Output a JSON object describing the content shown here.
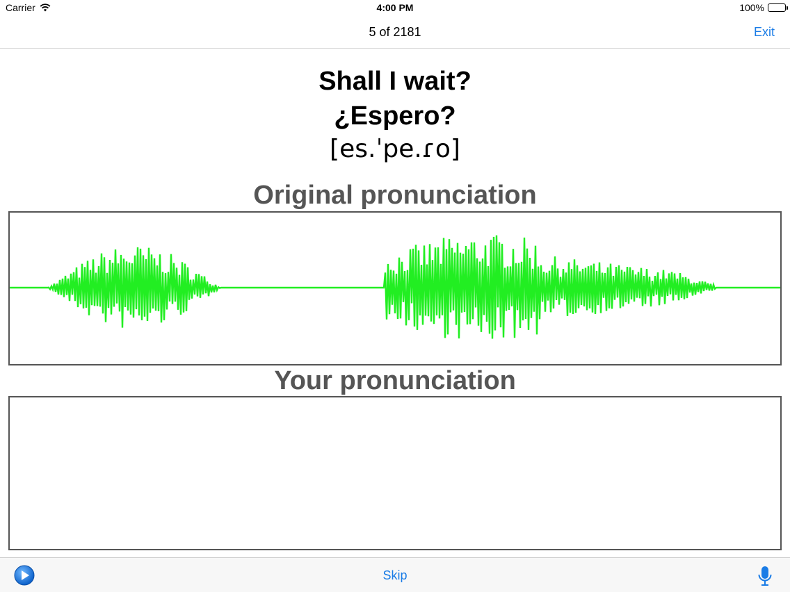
{
  "status_bar": {
    "carrier": "Carrier",
    "time": "4:00 PM",
    "battery": "100%"
  },
  "nav": {
    "title": "5 of 2181",
    "exit_label": "Exit"
  },
  "phrase": {
    "english": "Shall I wait?",
    "spanish": "¿Espero?",
    "ipa": "[es.ˈpe.ɾo]"
  },
  "sections": {
    "original_label": "Original pronunciation",
    "yours_label": "Your pronunciation"
  },
  "toolbar": {
    "skip_label": "Skip"
  },
  "colors": {
    "accent": "#1a7ce6",
    "waveform": "#22ee22",
    "label_gray": "#555555"
  },
  "icons": {
    "play": "play-circle-icon",
    "mic": "microphone-icon",
    "wifi": "wifi-icon",
    "battery": "battery-icon"
  }
}
